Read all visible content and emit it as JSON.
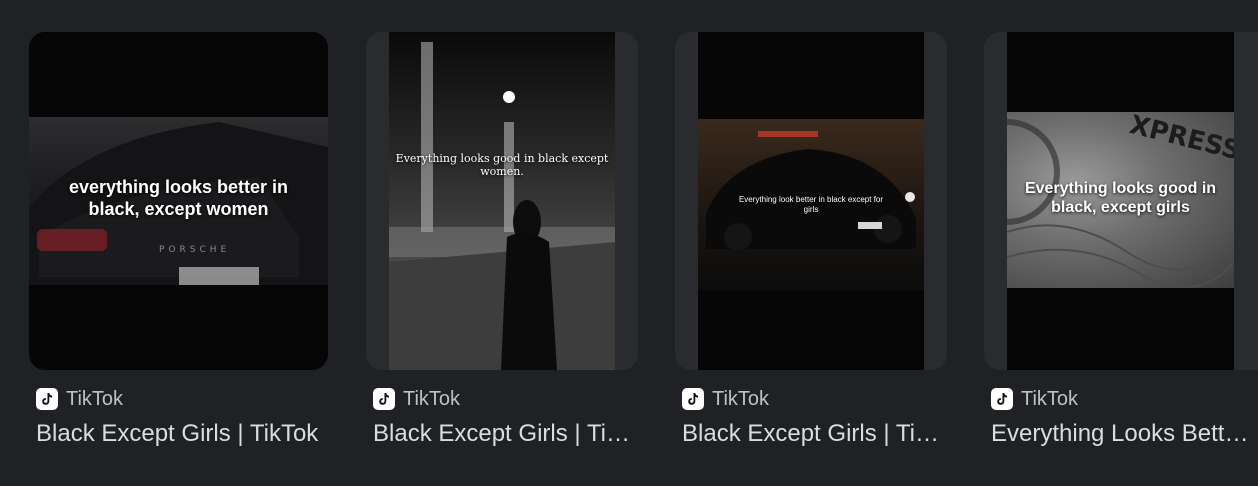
{
  "results": [
    {
      "source": "TikTok",
      "title": "Black Except Girls | TikTok",
      "thumbnail_overlay": "everything looks better in black, except women",
      "thumbnail_badge": "PORSCHE"
    },
    {
      "source": "TikTok",
      "title": "Black Except Girls | TikTok",
      "thumbnail_overlay": "Everything looks good in black except women."
    },
    {
      "source": "TikTok",
      "title": "Black Except Girls | TikTok",
      "thumbnail_overlay": "Everything look better in black except for girls"
    },
    {
      "source": "TikTok",
      "title": "Everything Looks Better In Black",
      "thumbnail_overlay": "Everything looks good in black, except girls",
      "thumbnail_badge": "XPRESS"
    }
  ],
  "colors": {
    "background": "#202124",
    "card_background": "#2a2b2f",
    "source_text": "#bdc1c6",
    "title_text": "#dadce0"
  },
  "icons": {
    "source_favicon": "tiktok-icon"
  }
}
